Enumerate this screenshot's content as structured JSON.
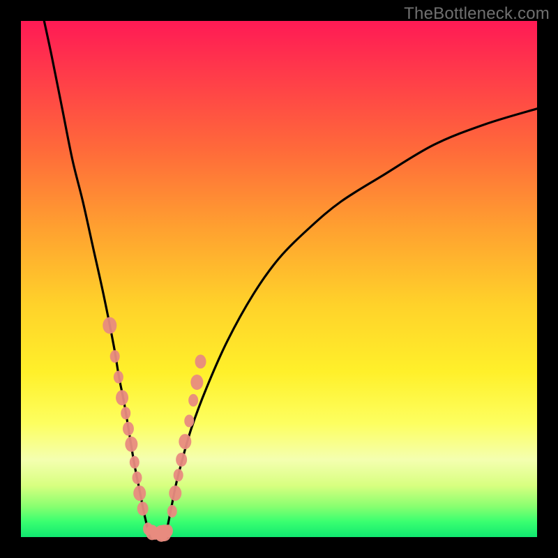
{
  "watermark": "TheBottleneck.com",
  "colors": {
    "frame": "#000000",
    "curve": "#000000",
    "marker": "#e88b80",
    "gradient_top": "#ff1a55",
    "gradient_bottom": "#10e870"
  },
  "chart_data": {
    "type": "line",
    "title": "",
    "xlabel": "",
    "ylabel": "",
    "xlim": [
      0,
      100
    ],
    "ylim": [
      0,
      100
    ],
    "grid": false,
    "legend": false,
    "series": [
      {
        "name": "left-branch",
        "x": [
          4.5,
          6,
          8,
          10,
          12,
          14,
          16,
          18,
          19,
          20,
          21,
          22,
          23,
          24,
          25
        ],
        "y": [
          100,
          93,
          83,
          73,
          65,
          56,
          47,
          37,
          31,
          26,
          20,
          14,
          9,
          4,
          0
        ]
      },
      {
        "name": "right-branch",
        "x": [
          28,
          29,
          30,
          31,
          33,
          36,
          40,
          45,
          50,
          56,
          62,
          70,
          80,
          90,
          100
        ],
        "y": [
          0,
          5,
          10,
          14,
          21,
          29,
          38,
          47,
          54,
          60,
          65,
          70,
          76,
          80,
          83
        ]
      }
    ],
    "markers_left": {
      "name": "left-markers",
      "x": [
        17.2,
        18.2,
        18.9,
        19.6,
        20.3,
        20.8,
        21.4,
        22.0,
        22.5,
        23.0,
        23.6,
        24.6,
        25.4,
        26.0,
        26.6,
        27.2
      ],
      "y": [
        41,
        35,
        31,
        27,
        24,
        21,
        18,
        14.5,
        11.5,
        8.5,
        5.5,
        1.6,
        0.9,
        0.7,
        0.7,
        0.7
      ]
    },
    "markers_right": {
      "name": "right-markers",
      "x": [
        27.8,
        28.5,
        29.3,
        29.9,
        30.5,
        31.1,
        31.8,
        32.6,
        33.4,
        34.1,
        34.8
      ],
      "y": [
        0.8,
        1.2,
        5.0,
        8.5,
        12,
        15,
        18.5,
        22.5,
        26.5,
        30,
        34
      ]
    }
  }
}
